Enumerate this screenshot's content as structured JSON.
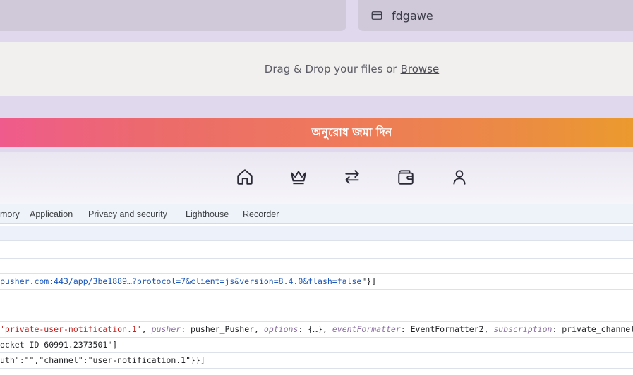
{
  "form": {
    "right_field_value": "fdgawe",
    "right_field_icon": "card-icon"
  },
  "dropzone": {
    "text": "Drag & Drop your files or",
    "browse_label": "Browse"
  },
  "submit_button": {
    "label": "অনুরোধ জমা দিন"
  },
  "bottom_nav": {
    "icons": [
      "home-icon",
      "crown-icon",
      "transfer-arrows-icon",
      "wallet-icon",
      "user-icon"
    ]
  },
  "devtools": {
    "tabs": [
      "mory",
      "Application",
      "Privacy and security",
      "Lighthouse",
      "Recorder"
    ],
    "console": {
      "line1_link": "pusher.com:443/app/3be1889…?protocol=7&client=js&version=8.4.0&flash=false",
      "line1_tail": "\"}]",
      "line2": {
        "str": "'private-user-notification.1'",
        "sep1": ", ",
        "k_pusher": "pusher",
        "v_pusher": ": pusher_Pusher, ",
        "k_options": "options",
        "v_options": ": {…}, ",
        "k_eventFormatter": "eventFormatter",
        "v_eventFormatter": ": EventFormatter2, ",
        "k_subscription": "subscription",
        "v_subscription": ": private_channel_Priva"
      },
      "line3": "ocket ID 60991.2373501\"]",
      "line4": "uth\":\"\",\"channel\":\"user-notification.1\"}}]"
    }
  }
}
